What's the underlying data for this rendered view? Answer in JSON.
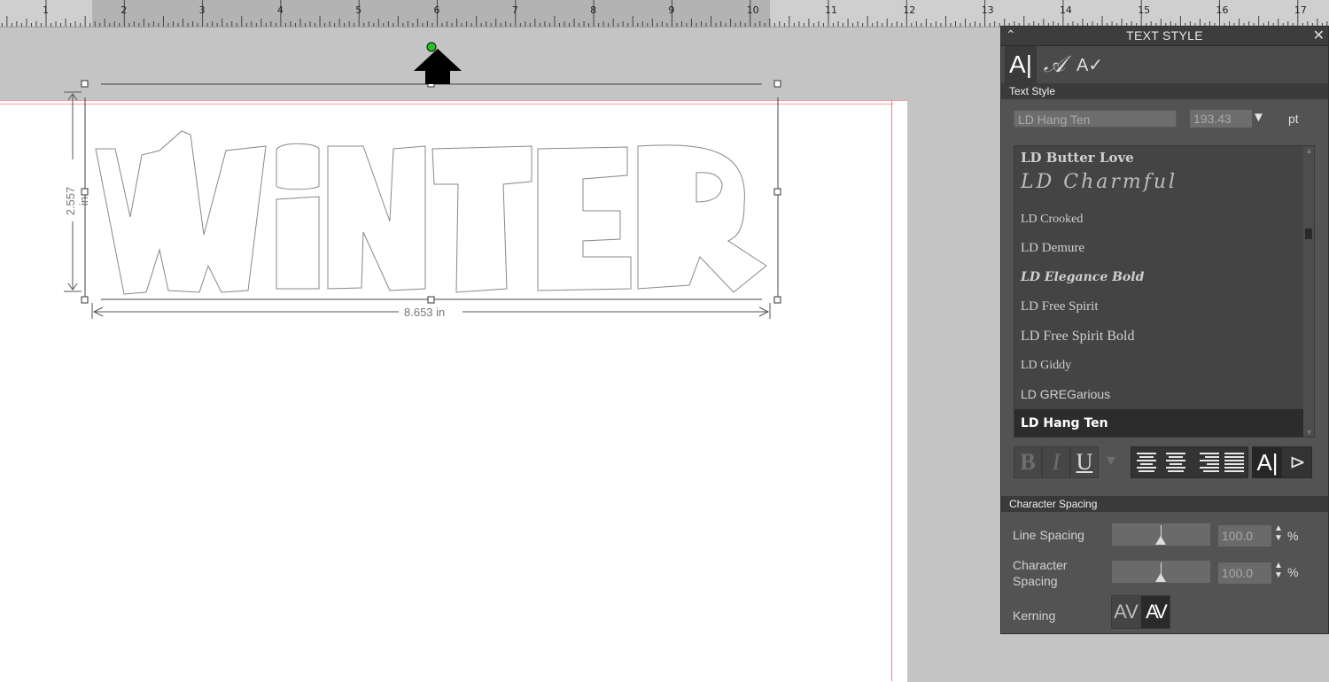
{
  "ruler": {
    "numbers": [
      "1",
      "2",
      "3",
      "4",
      "5",
      "6",
      "7",
      "8",
      "9",
      "10",
      "11",
      "12",
      "13",
      "14",
      "15",
      "16",
      "17"
    ]
  },
  "canvas": {
    "text": "WiNTER",
    "width_label": "8.653 in",
    "height_label": "2.557 in"
  },
  "panel": {
    "title": "TEXT STYLE",
    "collapse_icon": "chevron-up-icon",
    "close_label": "✕",
    "tabs": [
      {
        "label": "A|",
        "icon": "text-style-icon"
      },
      {
        "label": "𝒜",
        "icon": "text-effects-icon"
      },
      {
        "label": "A✓",
        "icon": "spelling-icon"
      }
    ],
    "text_style_header": "Text Style",
    "font_name": "LD Hang Ten",
    "font_size": "193.43",
    "font_unit": "pt",
    "fonts": [
      "LD Butter Love",
      "LD Charmful",
      "LD Crooked",
      "LD Demure",
      "LD Elegance Bold",
      "LD Free Spirit",
      "LD Free Spirit Bold",
      "LD Giddy",
      "LD GREGarious",
      "LD Hang Ten"
    ],
    "selected_font": "LD Hang Ten",
    "format_buttons": {
      "bold": "B",
      "italic": "I",
      "underline": "U"
    },
    "character_spacing_header": "Character Spacing",
    "line_spacing_label": "Line Spacing",
    "line_spacing_value": "100.0",
    "character_spacing_label": "Character Spacing",
    "character_spacing_value": "100.0",
    "percent": "%",
    "kerning_label": "Kerning",
    "kerning_a": "AV",
    "kerning_b": "AV"
  },
  "colors": {
    "panel_bg": "#535353",
    "panel_dark": "#3a3a3a",
    "rotation_handle": "#22c322",
    "page_margin": "#e08a8a"
  }
}
